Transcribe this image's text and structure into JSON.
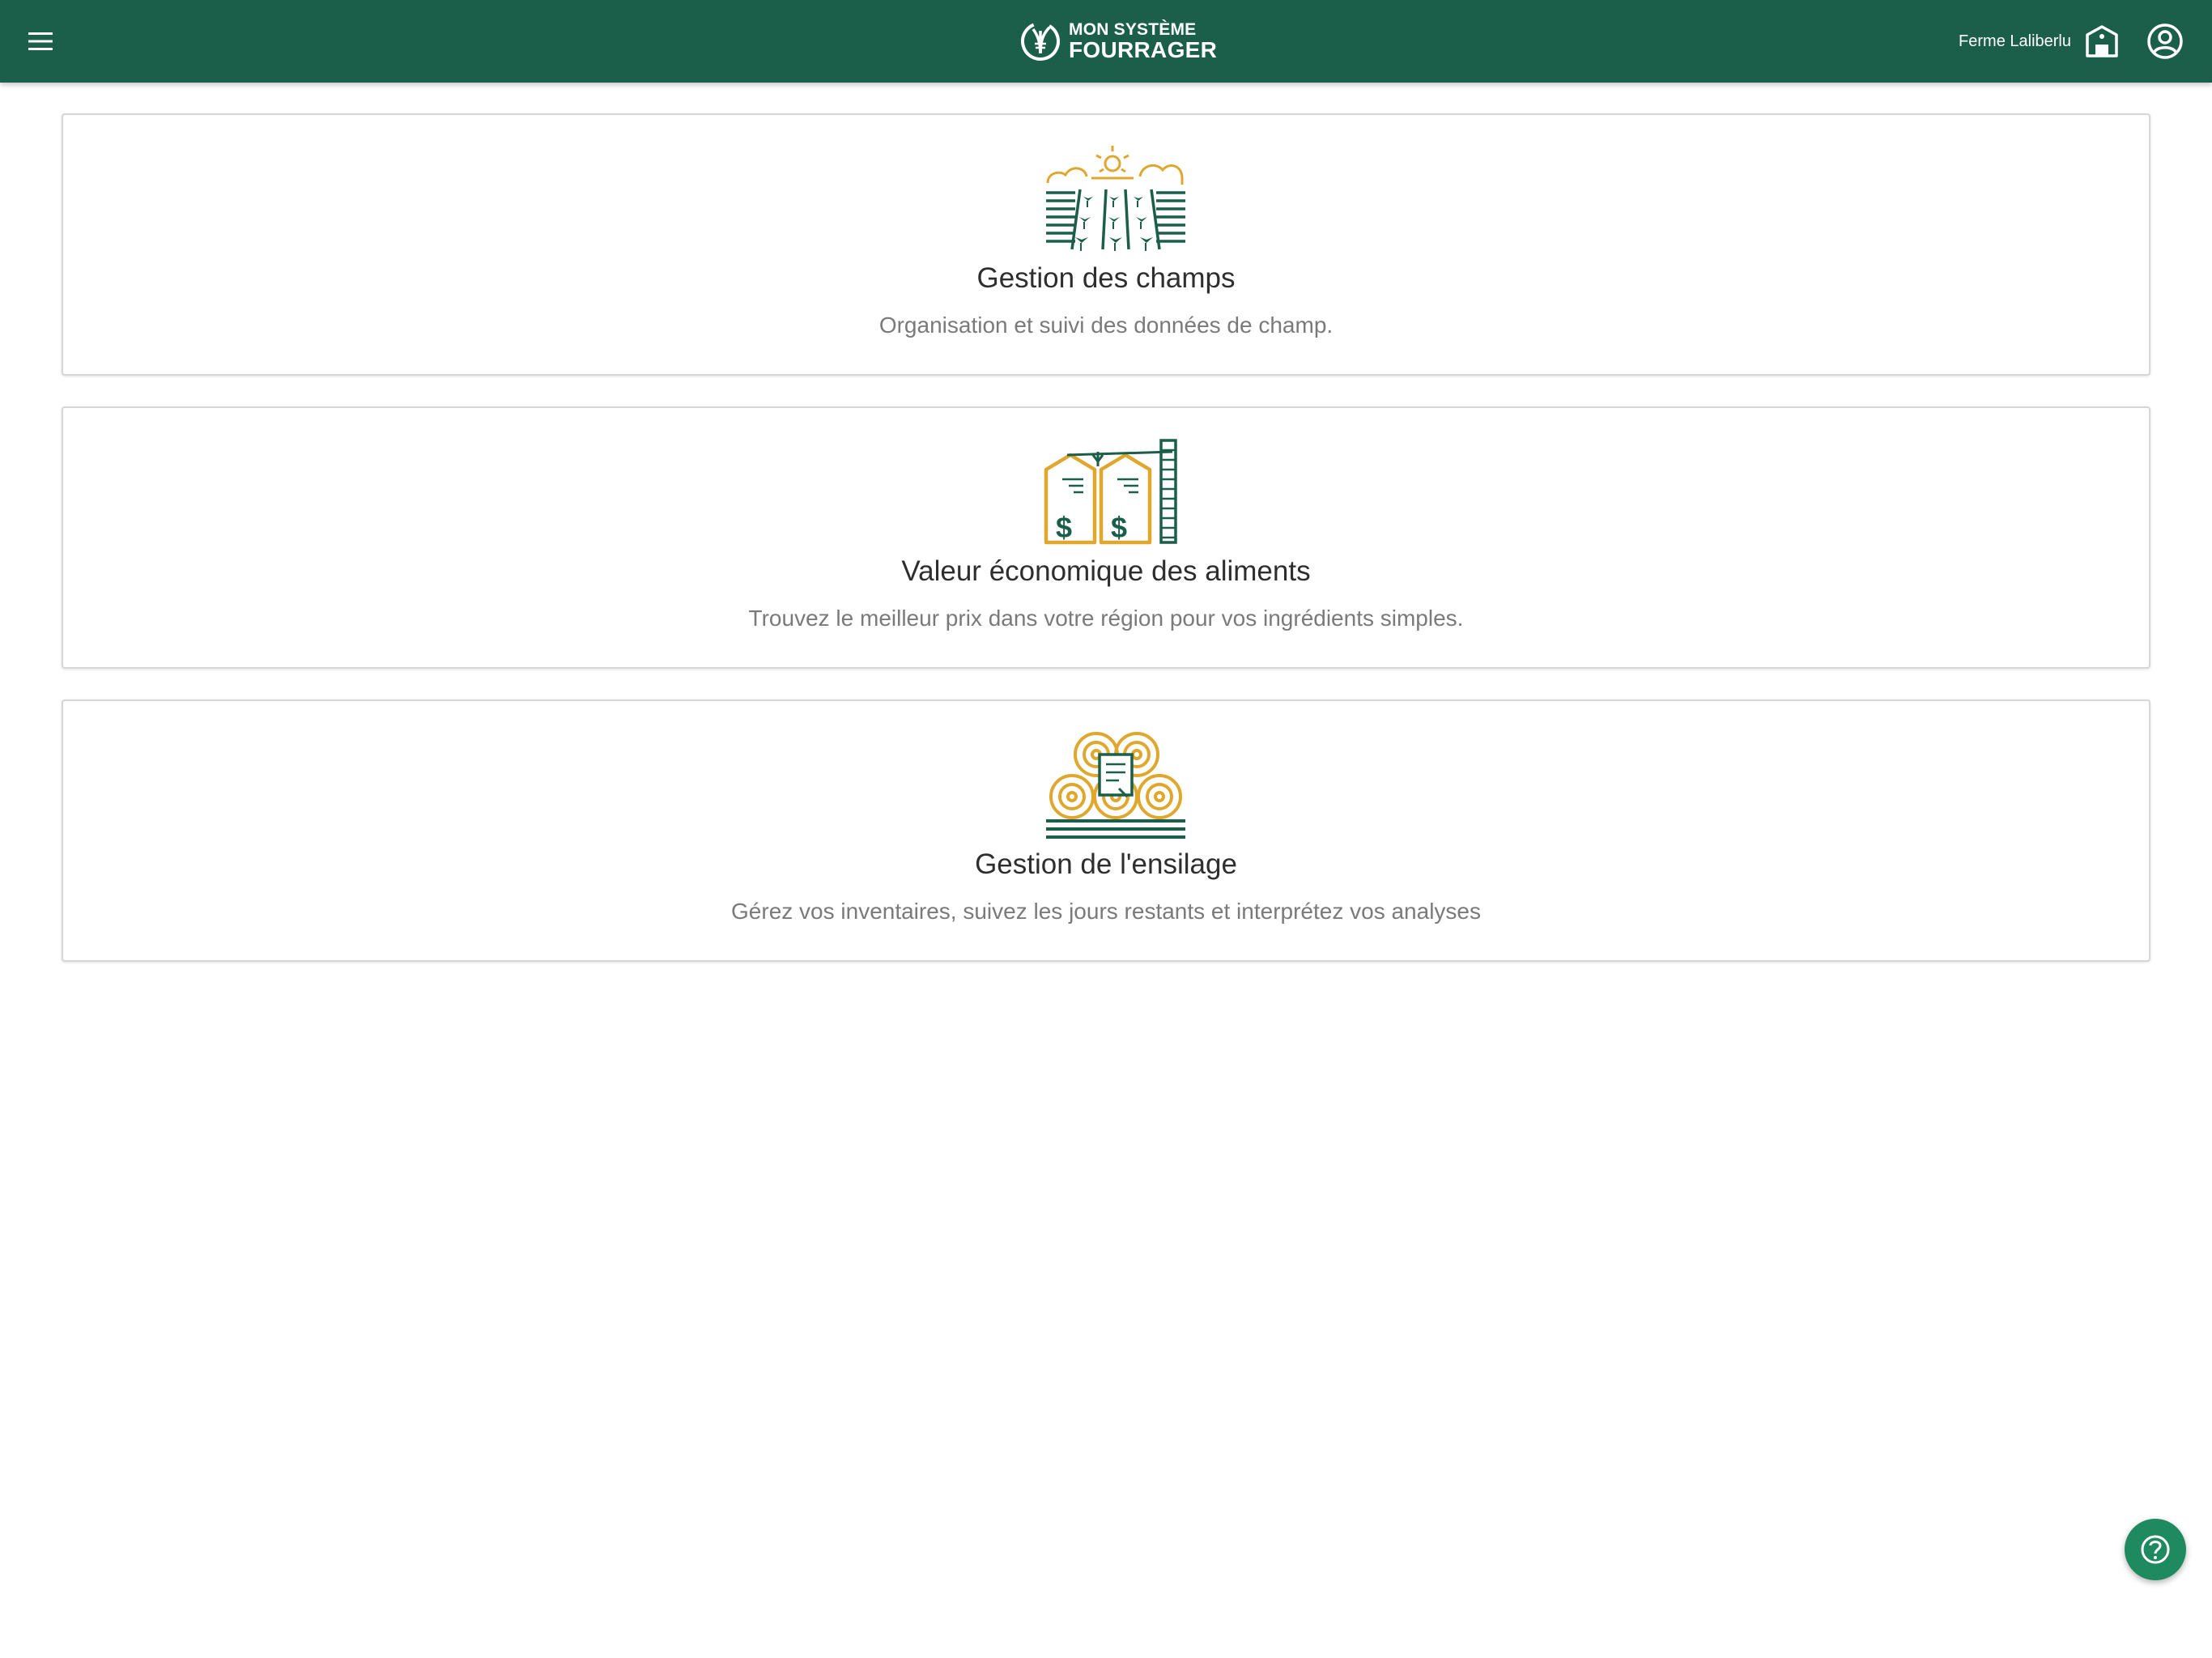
{
  "header": {
    "logo_line1": "MON SYSTÈME",
    "logo_line2": "FOURRAGER",
    "farm_name": "Ferme Laliberlu",
    "menu_icon": "hamburger-menu-icon",
    "farm_icon": "barn-icon",
    "account_icon": "account-circle-icon"
  },
  "cards": [
    {
      "icon": "field-sun-crops-icon",
      "title": "Gestion des champs",
      "description": "Organisation et suivi des données de champ."
    },
    {
      "icon": "silo-price-icon",
      "title": "Valeur économique des aliments",
      "description": "Trouvez le meilleur prix dans votre région pour vos ingrédients simples."
    },
    {
      "icon": "hay-bales-icon",
      "title": "Gestion de l'ensilage",
      "description": "Gérez vos inventaires, suivez les jours restants et interprétez vos analyses"
    }
  ],
  "help": {
    "icon": "help-circle-icon"
  },
  "colors": {
    "header_bg": "#1b5e4a",
    "icon_green": "#1b5e4a",
    "icon_gold": "#e0a72e",
    "help_button": "#1f8a5f"
  }
}
